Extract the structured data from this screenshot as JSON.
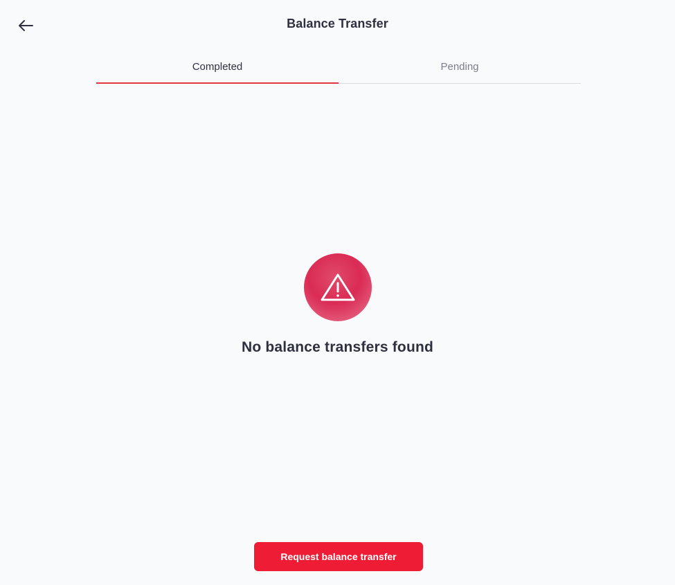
{
  "header": {
    "title": "Balance Transfer",
    "back_icon": "arrow-left-icon"
  },
  "tabs": [
    {
      "label": "Completed",
      "active": true
    },
    {
      "label": "Pending",
      "active": false
    }
  ],
  "empty_state": {
    "icon": "warning-triangle-icon",
    "message": "No balance transfers found"
  },
  "actions": {
    "request_label": "Request balance transfer"
  },
  "colors": {
    "accent": "#ee1d35",
    "tab_underline": "#e23344",
    "background": "#f9fafc",
    "text": "#2e3040"
  }
}
